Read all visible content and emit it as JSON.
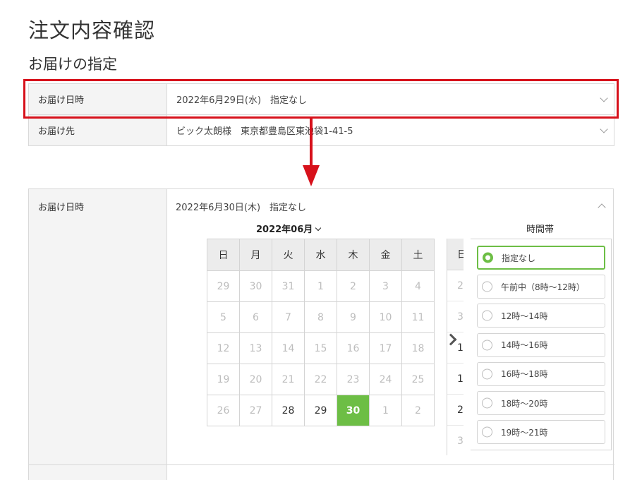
{
  "page_title": "注文内容確認",
  "section_title": "お届けの指定",
  "summary": {
    "delivery_date_label": "お届け日時",
    "delivery_date_value": "2022年6月29日(水)　指定なし",
    "delivery_address_label": "お届け先",
    "delivery_address_value": "ビック太朗様　東京都豊島区東池袋1-41-5"
  },
  "expanded": {
    "label": "お届け日時",
    "value": "2022年6月30日(木)　指定なし",
    "month": "2022年06月",
    "weekdays": [
      "日",
      "月",
      "火",
      "水",
      "木",
      "金",
      "土"
    ],
    "weeks": [
      [
        "29",
        "30",
        "31",
        "1",
        "2",
        "3",
        "4"
      ],
      [
        "5",
        "6",
        "7",
        "8",
        "9",
        "10",
        "11"
      ],
      [
        "12",
        "13",
        "14",
        "15",
        "16",
        "17",
        "18"
      ],
      [
        "19",
        "20",
        "21",
        "22",
        "23",
        "24",
        "25"
      ],
      [
        "26",
        "27",
        "28",
        "29",
        "30",
        "1",
        "2"
      ]
    ],
    "next_month_col_head": "日",
    "next_month_col": [
      "2",
      "3",
      "1",
      "1",
      "2",
      "3"
    ],
    "time_title": "時間帯",
    "time_options": [
      "指定なし",
      "午前中（8時～12時）",
      "12時～14時",
      "14時～16時",
      "16時～18時",
      "18時～20時",
      "19時～21時"
    ],
    "accent_color": "#6dbe45",
    "highlight_color": "#d7111b"
  }
}
